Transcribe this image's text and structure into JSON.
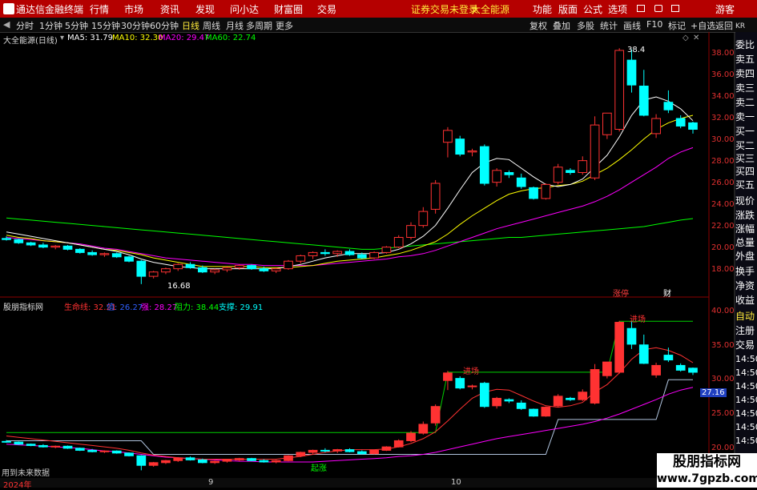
{
  "menubar": {
    "app": "通达信金融终端",
    "items": [
      "行情",
      "市场",
      "资讯",
      "发现",
      "问小达",
      "财富圈",
      "交易"
    ],
    "warning": "证券交易未登录",
    "warning2": "大全能源",
    "right": [
      "功能",
      "版面",
      "公式",
      "选项"
    ],
    "guest": "游客"
  },
  "tabbar": {
    "periods": [
      "分时",
      "1分钟",
      "5分钟",
      "15分钟",
      "30分钟",
      "60分钟",
      "日线",
      "周线",
      "月线",
      "多周期",
      "更多"
    ],
    "selected": "日线",
    "right": [
      "复权",
      "叠加",
      "多股",
      "统计",
      "画线",
      "F10",
      "标记",
      "+自选",
      "返回"
    ]
  },
  "main_legend": {
    "stock": "大全能源(日线)",
    "ma5": "MA5: 31.79",
    "ma10": "MA10: 32.30",
    "ma20": "MA20: 29.47",
    "ma60": "MA60: 22.74"
  },
  "main_axis": [
    "38.00",
    "36.00",
    "34.00",
    "32.00",
    "30.00",
    "28.00",
    "26.00",
    "24.00",
    "22.00",
    "20.00",
    "18.00"
  ],
  "main_annotations": {
    "high": "38.4",
    "low": "16.68",
    "tag1": "涨停",
    "tag2": "财"
  },
  "ind_legend": {
    "name": "股朋指标网",
    "life": "生命线: 32.21",
    "zhi": "值: 26.27",
    "qiang": "强: 28.27",
    "zuli": "阻力: 38.44",
    "zhicheng": "支撑: 29.91"
  },
  "ind_axis": [
    "40.00",
    "35.00",
    "30.00",
    "25.00",
    "20.00"
  ],
  "ind_value_box": "27.16",
  "ind_annotations": {
    "a1": "进场",
    "a2": "进场",
    "a3": "起涨"
  },
  "right_panel": [
    "委比",
    "卖五",
    "卖四",
    "卖三",
    "卖二",
    "卖一",
    "买一",
    "买二",
    "买三",
    "买四",
    "买五",
    "现价",
    "涨跌",
    "涨幅",
    "总量",
    "外盘",
    "换手",
    "净资",
    "收益"
  ],
  "right_panel2": [
    "自动",
    "注册",
    "交易",
    "14:50",
    "14:50",
    "14:50",
    "14:50",
    "14:50",
    "14:50",
    "14:50"
  ],
  "right_top": "KR",
  "bottom": {
    "note": "用到未来数据",
    "dates": [
      "2024年",
      "9",
      "10"
    ]
  },
  "watermark": {
    "brand": "股朋指标网",
    "url": "www.7gpzb.com"
  },
  "colors": {
    "up": "#ff3232",
    "down": "#00ffff",
    "ma5": "#ffffff",
    "ma10": "#ffff00",
    "ma20": "#ff00ff",
    "ma60": "#00ff00",
    "menubar": "#b50000"
  },
  "chart_data": {
    "type": "candlestick",
    "y_range": [
      17,
      39
    ],
    "candles": [
      [
        20.9,
        21.1,
        20.7,
        20.8
      ],
      [
        20.8,
        20.9,
        20.4,
        20.5
      ],
      [
        20.5,
        20.6,
        20.2,
        20.3
      ],
      [
        20.3,
        20.5,
        20.0,
        20.1
      ],
      [
        20.1,
        20.3,
        19.9,
        20.2
      ],
      [
        20.2,
        20.3,
        19.8,
        19.9
      ],
      [
        19.9,
        20.0,
        19.5,
        19.6
      ],
      [
        19.6,
        19.8,
        19.3,
        19.4
      ],
      [
        19.4,
        19.6,
        19.2,
        19.5
      ],
      [
        19.5,
        19.6,
        19.1,
        19.2
      ],
      [
        19.2,
        19.3,
        18.7,
        18.8
      ],
      [
        18.8,
        18.9,
        16.68,
        17.4
      ],
      [
        17.4,
        17.9,
        17.2,
        17.8
      ],
      [
        17.8,
        18.2,
        17.6,
        18.1
      ],
      [
        18.1,
        18.6,
        17.9,
        18.5
      ],
      [
        18.5,
        18.7,
        18.1,
        18.2
      ],
      [
        18.2,
        18.4,
        17.7,
        17.8
      ],
      [
        17.8,
        18.1,
        17.6,
        18.0
      ],
      [
        18.0,
        18.3,
        17.8,
        18.2
      ],
      [
        18.2,
        18.5,
        18.0,
        18.4
      ],
      [
        18.4,
        18.5,
        18.0,
        18.1
      ],
      [
        18.1,
        18.3,
        17.8,
        17.9
      ],
      [
        17.9,
        18.2,
        17.7,
        18.1
      ],
      [
        18.1,
        18.9,
        18.0,
        18.8
      ],
      [
        18.8,
        19.4,
        18.6,
        19.3
      ],
      [
        19.3,
        19.7,
        19.0,
        19.6
      ],
      [
        19.6,
        19.9,
        19.3,
        19.5
      ],
      [
        19.5,
        19.8,
        19.2,
        19.7
      ],
      [
        19.7,
        19.9,
        19.3,
        19.4
      ],
      [
        19.4,
        19.6,
        19.0,
        19.1
      ],
      [
        19.1,
        19.7,
        19.0,
        19.6
      ],
      [
        19.6,
        20.2,
        19.5,
        20.1
      ],
      [
        20.1,
        21.2,
        20.0,
        21.0
      ],
      [
        21.0,
        22.4,
        20.8,
        22.1
      ],
      [
        22.1,
        23.8,
        21.9,
        23.4
      ],
      [
        23.6,
        26.3,
        23.2,
        26.0
      ],
      [
        29.8,
        31.2,
        28.4,
        30.9
      ],
      [
        30.1,
        30.4,
        28.5,
        28.7
      ],
      [
        28.9,
        29.2,
        28.5,
        29.0
      ],
      [
        29.4,
        29.6,
        25.8,
        26.0
      ],
      [
        26.1,
        27.4,
        25.7,
        27.2
      ],
      [
        27.0,
        27.2,
        26.5,
        26.8
      ],
      [
        26.5,
        26.9,
        25.5,
        25.7
      ],
      [
        25.6,
        25.7,
        24.5,
        24.6
      ],
      [
        24.6,
        26.0,
        24.5,
        25.9
      ],
      [
        26.1,
        27.8,
        25.9,
        27.5
      ],
      [
        27.2,
        27.4,
        26.8,
        27.0
      ],
      [
        27.0,
        28.5,
        26.8,
        28.1
      ],
      [
        26.5,
        32.2,
        26.3,
        31.4
      ],
      [
        30.5,
        32.5,
        30.1,
        32.5
      ],
      [
        31.0,
        38.5,
        30.8,
        38.3
      ],
      [
        37.4,
        38.4,
        34.4,
        35.1
      ],
      [
        35.0,
        36.5,
        32.2,
        32.3
      ],
      [
        30.6,
        32.4,
        30.2,
        32.0
      ],
      [
        33.5,
        34.6,
        32.5,
        32.8
      ],
      [
        32.0,
        32.3,
        31.1,
        31.3
      ],
      [
        31.6,
        31.7,
        30.6,
        31.0
      ]
    ],
    "ma5": [
      21.5,
      21.3,
      21.1,
      20.9,
      20.7,
      20.5,
      20.3,
      20.1,
      19.9,
      19.7,
      19.4,
      19.0,
      18.7,
      18.5,
      18.3,
      18.2,
      18.1,
      18.1,
      18.1,
      18.1,
      18.1,
      18.1,
      18.1,
      18.3,
      18.5,
      18.8,
      19.1,
      19.3,
      19.5,
      19.5,
      19.5,
      19.6,
      19.9,
      20.4,
      21.1,
      22.1,
      23.7,
      25.4,
      27.0,
      27.9,
      28.3,
      28.2,
      27.4,
      26.6,
      25.9,
      25.7,
      25.9,
      26.4,
      27.5,
      28.6,
      30.3,
      32.3,
      33.7,
      34.0,
      33.6,
      32.9,
      31.8
    ],
    "ma10": [
      21.2,
      21.0,
      20.9,
      20.7,
      20.6,
      20.5,
      20.3,
      20.1,
      19.9,
      19.8,
      19.6,
      19.4,
      19.1,
      18.9,
      18.7,
      18.5,
      18.3,
      18.3,
      18.3,
      18.3,
      18.3,
      18.2,
      18.2,
      18.2,
      18.3,
      18.4,
      18.6,
      18.8,
      18.9,
      19.0,
      19.1,
      19.3,
      19.5,
      19.8,
      20.2,
      20.6,
      21.3,
      22.2,
      23.0,
      23.7,
      24.4,
      25.0,
      25.3,
      25.5,
      25.6,
      25.8,
      25.9,
      26.2,
      26.8,
      27.4,
      28.2,
      29.1,
      30.1,
      31.0,
      31.6,
      32.0,
      32.3
    ],
    "ma20": [
      21.0,
      20.9,
      20.8,
      20.7,
      20.6,
      20.5,
      20.4,
      20.2,
      20.0,
      19.9,
      19.7,
      19.5,
      19.3,
      19.1,
      19.0,
      18.9,
      18.8,
      18.7,
      18.6,
      18.5,
      18.5,
      18.4,
      18.4,
      18.4,
      18.4,
      18.4,
      18.5,
      18.6,
      18.7,
      18.8,
      18.9,
      19.0,
      19.2,
      19.3,
      19.5,
      19.8,
      20.2,
      20.6,
      21.0,
      21.4,
      21.8,
      22.1,
      22.4,
      22.7,
      23.0,
      23.3,
      23.6,
      23.9,
      24.3,
      24.8,
      25.4,
      26.1,
      26.8,
      27.5,
      28.3,
      28.9,
      29.3
    ],
    "ma60": [
      22.8,
      22.7,
      22.6,
      22.5,
      22.4,
      22.3,
      22.2,
      22.1,
      22.0,
      21.9,
      21.8,
      21.7,
      21.6,
      21.5,
      21.4,
      21.3,
      21.2,
      21.1,
      21.0,
      20.9,
      20.8,
      20.7,
      20.6,
      20.5,
      20.4,
      20.3,
      20.2,
      20.1,
      20.0,
      19.9,
      19.9,
      20.0,
      20.1,
      20.2,
      20.3,
      20.4,
      20.5,
      20.6,
      20.7,
      20.8,
      20.9,
      21.0,
      21.0,
      21.1,
      21.2,
      21.3,
      21.4,
      21.5,
      21.6,
      21.7,
      21.8,
      21.9,
      22.0,
      22.2,
      22.4,
      22.6,
      22.74
    ]
  }
}
